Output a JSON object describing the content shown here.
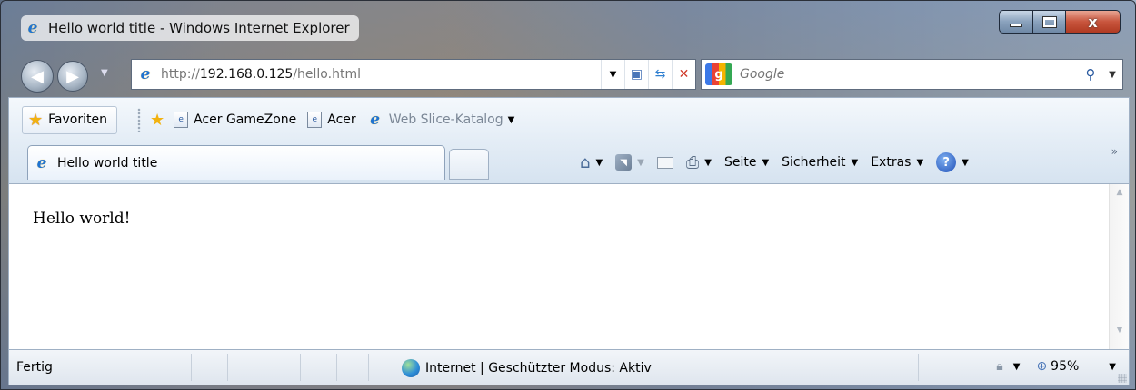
{
  "window": {
    "title": "Hello world title - Windows Internet Explorer",
    "controls": {
      "minimize": "",
      "maximize": "",
      "close": "x"
    }
  },
  "nav": {
    "address_prefix": "http://",
    "address_host": "192.168.0.125",
    "address_path": "/hello.html",
    "search_placeholder": "Google"
  },
  "favorites_bar": {
    "favorites_label": "Favoriten",
    "items": [
      {
        "label": "Acer GameZone"
      },
      {
        "label": "Acer"
      },
      {
        "label": "Web Slice-Katalog"
      }
    ]
  },
  "tabs": [
    {
      "label": "Hello world title",
      "active": true
    }
  ],
  "command_bar": {
    "page_label": "Seite",
    "safety_label": "Sicherheit",
    "tools_label": "Extras",
    "overflow": "»"
  },
  "content": {
    "text": "Hello world!"
  },
  "status_bar": {
    "status": "Fertig",
    "zone": "Internet | Geschützter Modus: Aktiv",
    "zoom": "95%"
  },
  "icons": {
    "browser": "ie-icon",
    "favorites": "star-icon",
    "home": "home-icon",
    "feeds": "rss-icon",
    "mail": "mail-icon",
    "print": "print-icon",
    "help": "help-icon",
    "zone": "globe-icon"
  }
}
